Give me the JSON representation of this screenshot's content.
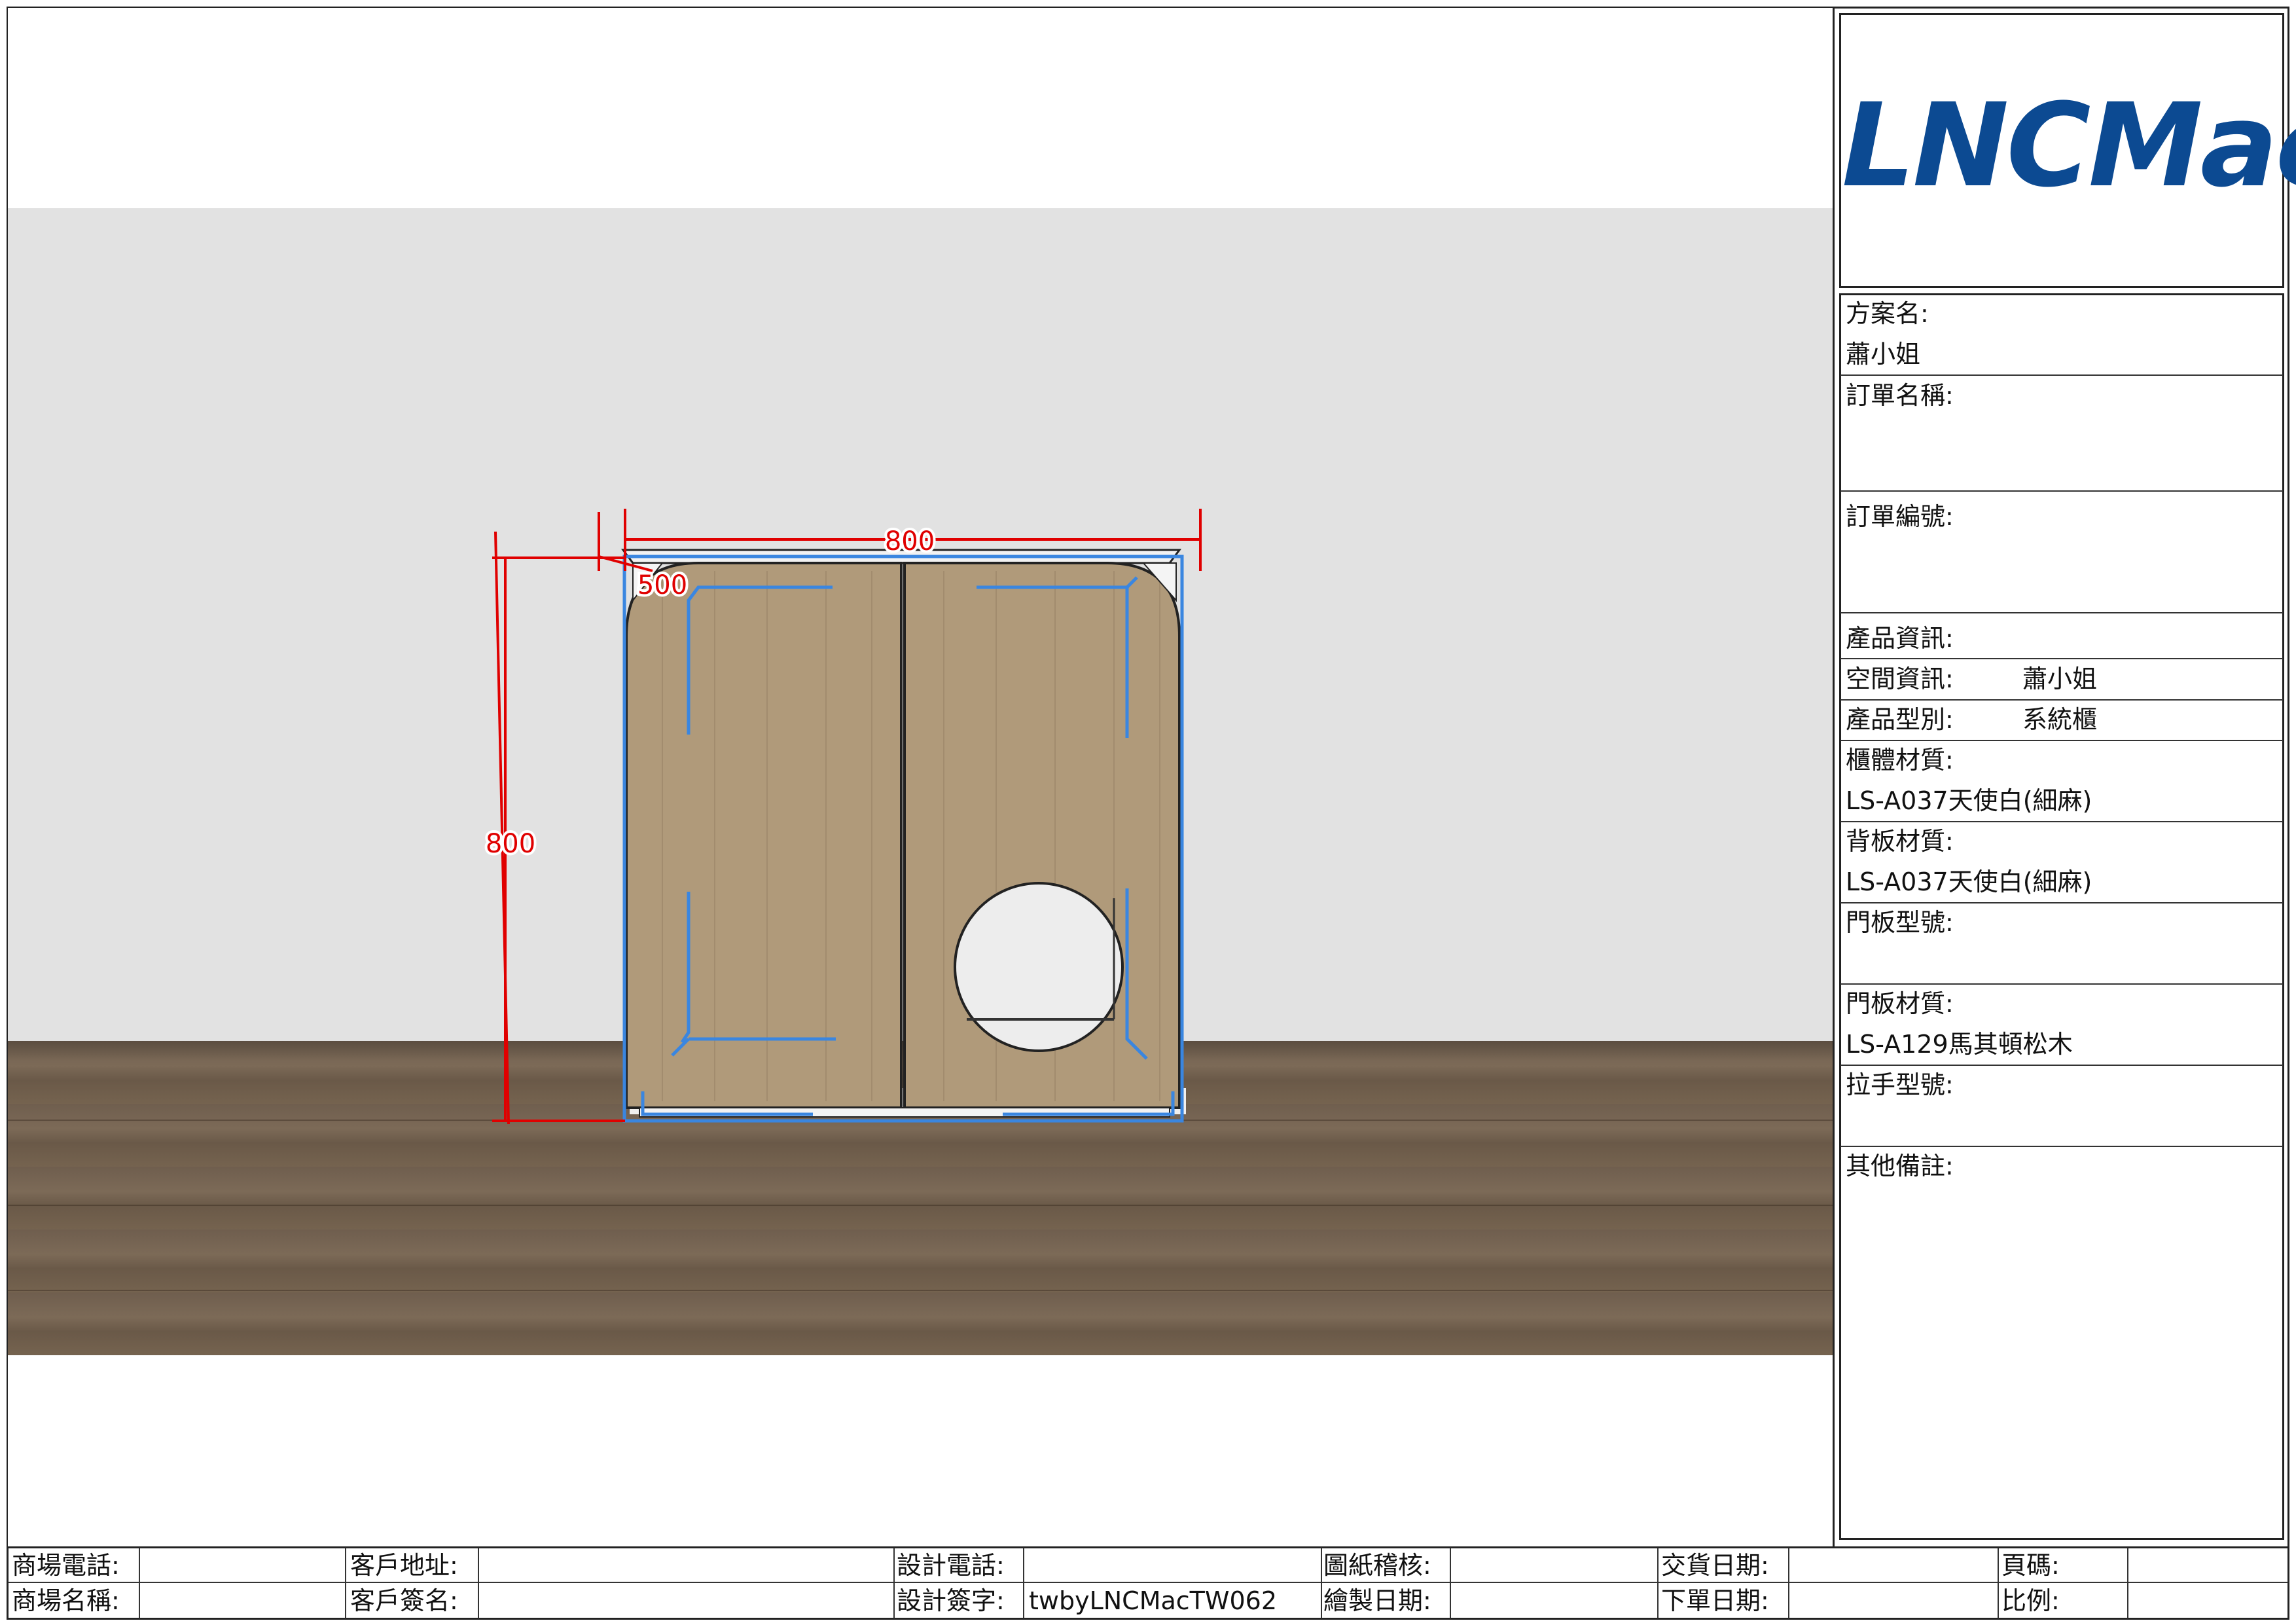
{
  "brand": {
    "logo_text": "LNCMac",
    "logo_color": "#0c4a92"
  },
  "drawing": {
    "dimensions": {
      "width_label": "800",
      "height_label": "800",
      "depth_label": "500"
    },
    "colors": {
      "dimension": "#e00000",
      "outline": "#3a86e0",
      "wood": "#b09a7a",
      "wall": "#e2e2e2",
      "floor": "#6e5d4c"
    }
  },
  "title_block": {
    "project_name_label": "方案名:",
    "project_name_value": "蕭小姐",
    "order_name_label": "訂單名稱:",
    "order_number_label": "訂單編號:",
    "product_info_label": "產品資訊:",
    "space_info_label": "空間資訊:",
    "space_info_value": "蕭小姐",
    "product_type_label": "產品型別:",
    "product_type_value": "系統櫃",
    "cabinet_material_label": "櫃體材質:",
    "cabinet_material_value": "LS-A037天使白(細麻)",
    "back_material_label": "背板材質:",
    "back_material_value": "LS-A037天使白(細麻)",
    "door_model_label": "門板型號:",
    "door_material_label": "門板材質:",
    "door_material_value": "LS-A129馬其頓松木",
    "handle_model_label": "拉手型號:",
    "remarks_label": "其他備註:"
  },
  "footer": {
    "store_phone_label": "商場電話:",
    "store_name_label": "商場名稱:",
    "customer_address_label": "客戶地址:",
    "customer_signature_label": "客戶簽名:",
    "design_phone_label": "設計電話:",
    "design_signature_label": "設計簽字:",
    "design_signature_value": "twbyLNCMacTW062",
    "drawing_review_label": "圖紙稽核:",
    "draw_date_label": "繪製日期:",
    "delivery_date_label": "交貨日期:",
    "order_date_label": "下單日期:",
    "page_label": "頁碼:",
    "scale_label": "比例:"
  }
}
